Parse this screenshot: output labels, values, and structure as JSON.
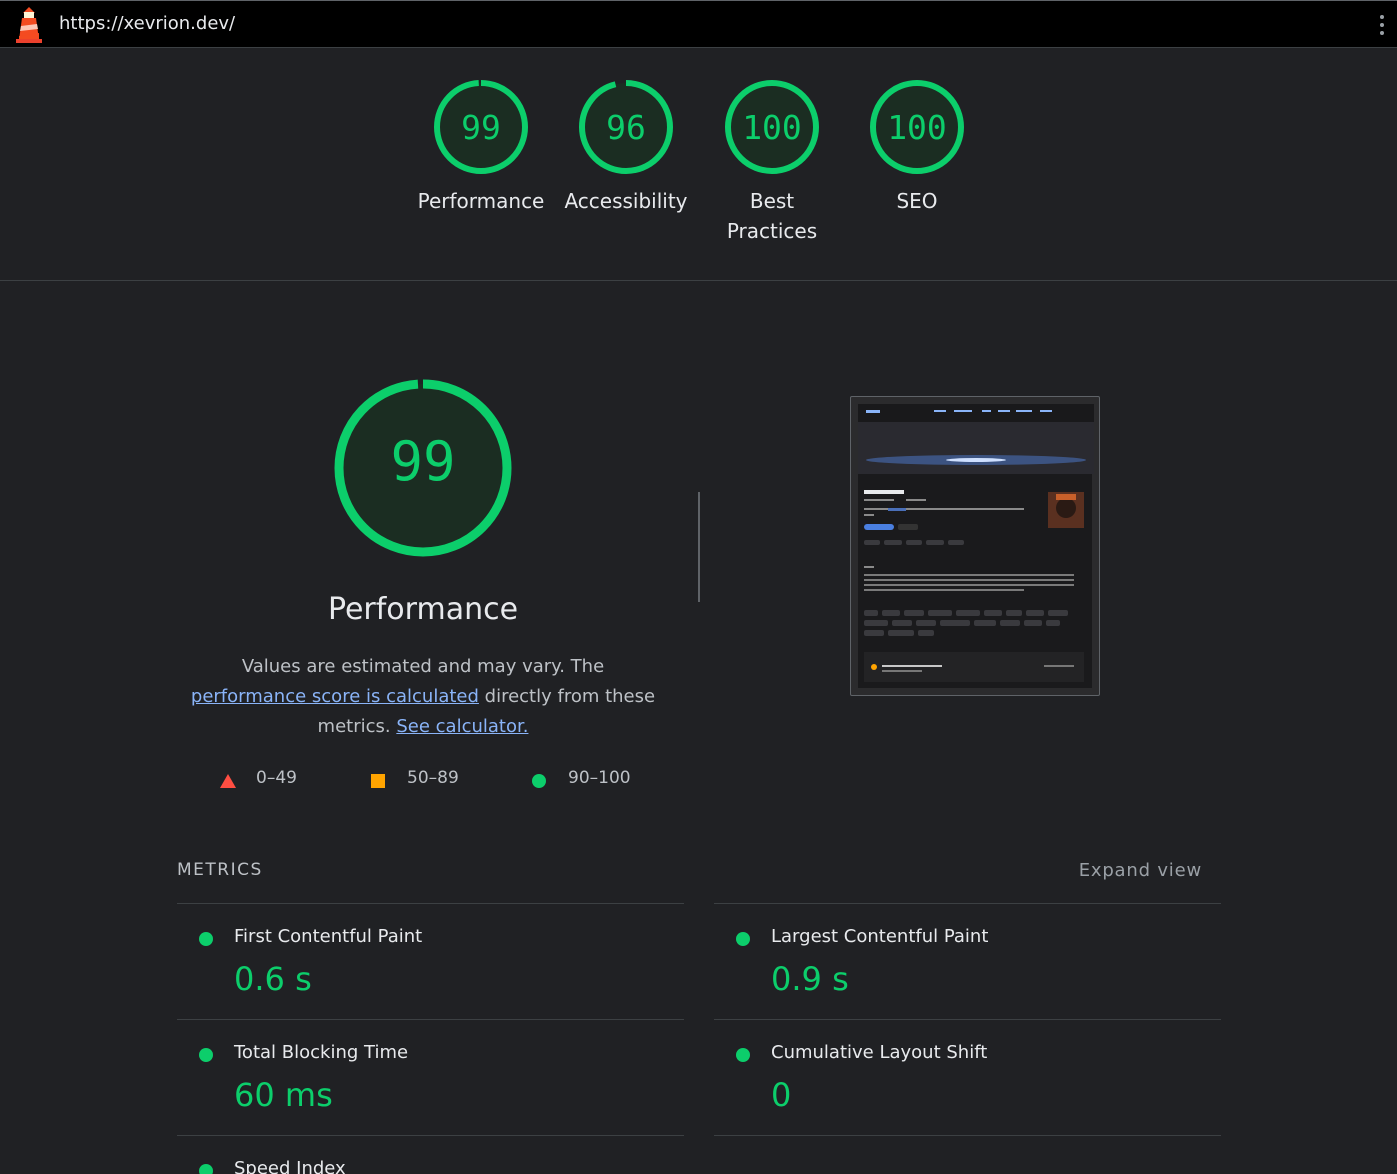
{
  "header": {
    "url": "https://xevrion.dev/",
    "logo_icon": "lighthouse-icon",
    "menu_icon": "kebab-menu-icon"
  },
  "summary_gauges": [
    {
      "score": "99",
      "label": "Performance"
    },
    {
      "score": "96",
      "label": "Accessibility"
    },
    {
      "score": "100",
      "label": "Best Practices"
    },
    {
      "score": "100",
      "label": "SEO"
    }
  ],
  "performance": {
    "score": "99",
    "title": "Performance",
    "desc_1": "Values are estimated and may vary. The ",
    "desc_link_1": "performance score is calculated",
    "desc_2": " directly from these metrics. ",
    "desc_link_2": "See calculator.",
    "legend": [
      {
        "range": "0–49",
        "shape": "triangle",
        "color": "#ff4e42"
      },
      {
        "range": "50–89",
        "shape": "square",
        "color": "#ffa400"
      },
      {
        "range": "90–100",
        "shape": "circle",
        "color": "#0cce6b"
      }
    ]
  },
  "metrics": {
    "heading": "METRICS",
    "expand_label": "Expand view",
    "items": [
      {
        "name": "First Contentful Paint",
        "value": "0.6 s"
      },
      {
        "name": "Largest Contentful Paint",
        "value": "0.9 s"
      },
      {
        "name": "Total Blocking Time",
        "value": "60 ms"
      },
      {
        "name": "Cumulative Layout Shift",
        "value": "0"
      },
      {
        "name": "Speed Index",
        "value": ""
      }
    ]
  },
  "colors": {
    "pass": "#0cce6b",
    "average": "#ffa400",
    "fail": "#ff4e42",
    "link": "#8ab4f8"
  },
  "screenshot": {
    "icon": "page-screenshot-thumbnail"
  }
}
